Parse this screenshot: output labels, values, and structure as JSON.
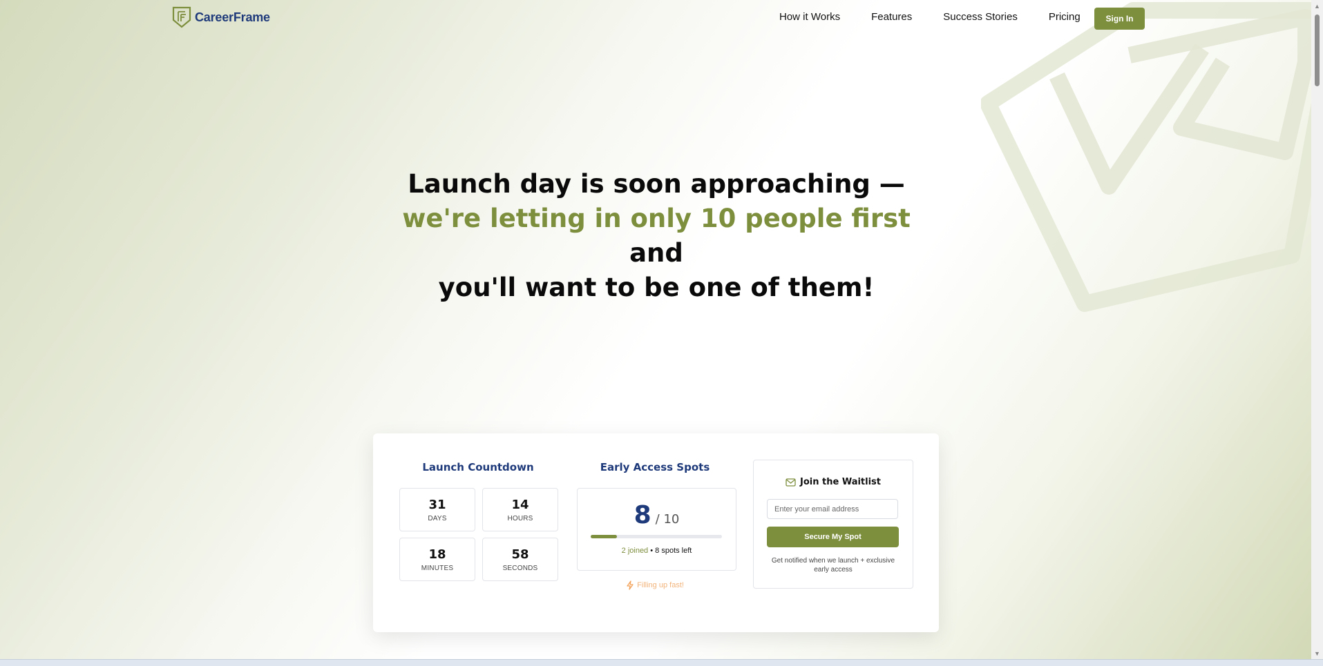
{
  "brand": {
    "name": "CareerFrame",
    "logo_icon": "cf-shield-logo-icon"
  },
  "nav": {
    "items": [
      "How it Works",
      "Features",
      "Success Stories",
      "Pricing"
    ],
    "signin_label": "Sign In"
  },
  "hero": {
    "line1": "Launch day is soon approaching —",
    "accent": "we're letting in only 10 people first",
    "after_accent": " and",
    "line3": "you'll want to be one of them!"
  },
  "countdown": {
    "title": "Launch Countdown",
    "tiles": [
      {
        "value": "31",
        "label": "DAYS"
      },
      {
        "value": "14",
        "label": "HOURS"
      },
      {
        "value": "18",
        "label": "MINUTES"
      },
      {
        "value": "58",
        "label": "SECONDS"
      }
    ]
  },
  "spots": {
    "title": "Early Access Spots",
    "count": "8",
    "total": "/ 10",
    "progress_fraction": 0.2,
    "joined_text": "2 joined",
    "separator": " • ",
    "left_text": "8 spots left",
    "filling_text": "Filling up fast!",
    "filling_icon": "lightning-icon"
  },
  "waitlist": {
    "icon": "mail-icon",
    "title": "Join the Waitlist",
    "email_placeholder": "Enter your email address",
    "email_value": "",
    "button_label": "Secure My Spot",
    "note": "Get notified when we launch + exclusive early access"
  },
  "colors": {
    "accent": "#7d8e3d",
    "navy": "#1f3a7a",
    "warning": "#f2b37a"
  }
}
